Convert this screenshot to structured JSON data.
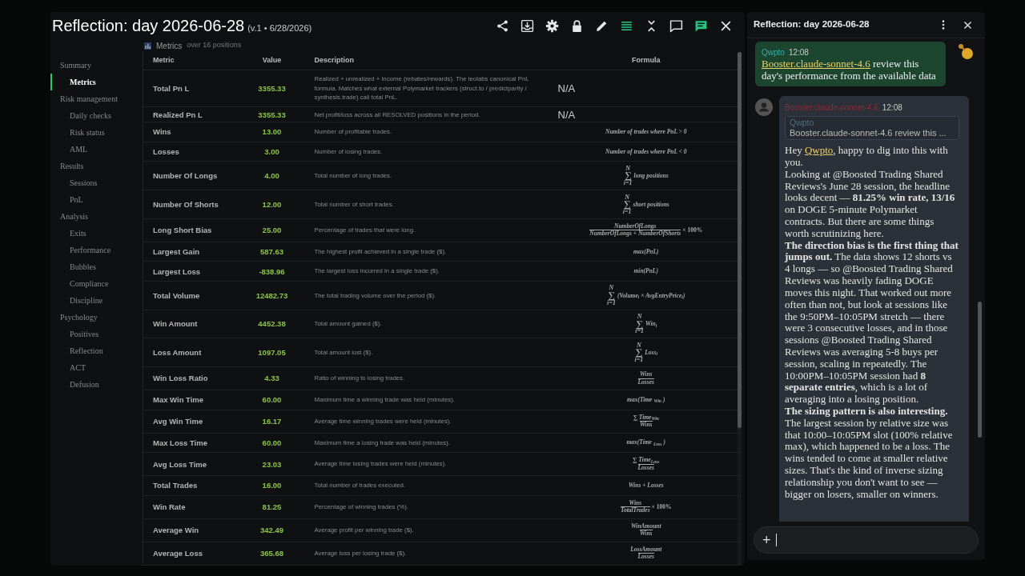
{
  "window": {
    "title": "Reflection: day 2026-06-28",
    "version": "(v.1 • 6/28/2026)"
  },
  "toolbar": [
    {
      "kind": "share",
      "active": false
    },
    {
      "kind": "download",
      "active": false
    },
    {
      "kind": "gear",
      "active": false
    },
    {
      "kind": "lock",
      "active": false
    },
    {
      "kind": "pencil",
      "active": false
    },
    {
      "kind": "list",
      "active": true
    },
    {
      "kind": "collapse",
      "active": false
    },
    {
      "kind": "comment",
      "active": false
    },
    {
      "kind": "comment",
      "active": true
    },
    {
      "kind": "close",
      "active": false
    }
  ],
  "sidebar": {
    "items": [
      {
        "label": "Summary",
        "selected": false,
        "children": [
          {
            "label": "Metrics",
            "selected": true
          }
        ]
      },
      {
        "label": "Risk management",
        "selected": false,
        "children": [
          {
            "label": "Daily checks",
            "selected": false
          },
          {
            "label": "Risk status",
            "selected": false
          },
          {
            "label": "AML",
            "selected": false
          }
        ]
      },
      {
        "label": "Results",
        "selected": false,
        "children": [
          {
            "label": "Sessions",
            "selected": false
          },
          {
            "label": "PnL",
            "selected": false
          }
        ]
      },
      {
        "label": "Analysis",
        "selected": false,
        "children": [
          {
            "label": "Exits",
            "selected": false
          },
          {
            "label": "Performance",
            "selected": false
          },
          {
            "label": "Bubbles",
            "selected": false
          },
          {
            "label": "Compliance",
            "selected": false
          },
          {
            "label": "Discipline",
            "selected": false
          }
        ]
      },
      {
        "label": "Psychology",
        "selected": false,
        "children": [
          {
            "label": "Positives",
            "selected": false
          },
          {
            "label": "Reflection",
            "selected": false
          },
          {
            "label": "ACT",
            "selected": false
          },
          {
            "label": "Defusion",
            "selected": false
          }
        ]
      }
    ]
  },
  "section": {
    "title": "Metrics",
    "subtitle": "over 16 positions"
  },
  "table": {
    "columns": [
      "Metric",
      "Value",
      "Description",
      "Formula"
    ],
    "rows": [
      {
        "metric": "Total Pn L",
        "value": "3355.33",
        "description": "Realized + unrealized + income (rebates/rewards). The leolabs canonical PnL formula. Matches what external Polymarket trackers (struct.to / predictparity / synthesis.trade) call total PnL.",
        "formula": {
          "kind": "na",
          "text": "N/A"
        }
      },
      {
        "metric": "Realized Pn L",
        "value": "3355.33",
        "description": "Net profit/loss across all RESOLVED positions in the period.",
        "formula": {
          "kind": "na",
          "text": "N/A"
        }
      },
      {
        "metric": "Wins",
        "value": "13.00",
        "description": "Number of profitable trades.",
        "formula": {
          "kind": "text",
          "text": "Number of trades where PnL > 0"
        }
      },
      {
        "metric": "Losses",
        "value": "3.00",
        "description": "Number of losing trades.",
        "formula": {
          "kind": "text",
          "text": "Number of trades where PnL < 0"
        }
      },
      {
        "metric": "Number Of Longs",
        "value": "4.00",
        "description": "Total number of long trades.",
        "formula": {
          "kind": "sum",
          "upper": "N",
          "sign": "∑",
          "lower": "i=1",
          "body": "long positions"
        }
      },
      {
        "metric": "Number Of Shorts",
        "value": "12.00",
        "description": "Total number of short trades.",
        "formula": {
          "kind": "sum",
          "upper": "N",
          "sign": "∑",
          "lower": "i=1",
          "body": "short positions"
        }
      },
      {
        "metric": "Long Short Bias",
        "value": "25.00",
        "description": "Percentage of trades that were long.",
        "formula": {
          "kind": "fraction",
          "num": "NumberOfLongs",
          "den": "NumberOfLongs + NumberOfShorts",
          "suffix": "× 100%"
        }
      },
      {
        "metric": "Largest Gain",
        "value": "587.63",
        "description": "The highest profit achieved in a single trade ($).",
        "formula": {
          "kind": "text",
          "text": "max(PnL)"
        }
      },
      {
        "metric": "Largest Loss",
        "value": "-838.96",
        "description": "The largest loss incurred in a single trade ($).",
        "formula": {
          "kind": "text",
          "text": "min(PnL)"
        }
      },
      {
        "metric": "Total Volume",
        "value": "12482.73",
        "description": "The total trading volume over the period ($).",
        "formula": {
          "kind": "sum",
          "upper": "N",
          "sign": "∑",
          "lower": "i=1",
          "body": "(Volume$_{i}$ × AvgEntryPrice$_{i}$)"
        }
      },
      {
        "metric": "Win Amount",
        "value": "4452.38",
        "description": "Total amount gained ($).",
        "formula": {
          "kind": "sum",
          "upper": "N",
          "sign": "∑",
          "lower": "i=1",
          "body": "Win$_{i}$"
        }
      },
      {
        "metric": "Loss Amount",
        "value": "1097.05",
        "description": "Total amount lost ($).",
        "formula": {
          "kind": "sum",
          "upper": "N",
          "sign": "∑",
          "lower": "i=1",
          "body": "Loss$_{i}$"
        }
      },
      {
        "metric": "Win Loss Ratio",
        "value": "4.33",
        "description": "Ratio of winning to losing trades.",
        "formula": {
          "kind": "fraction",
          "num": "Wins",
          "den": "Losses"
        }
      },
      {
        "metric": "Max Win Time",
        "value": "60.00",
        "description": "Maximum time a winning trade was held (minutes).",
        "formula": {
          "kind": "text",
          "text": "max(Time$_{Win}$)"
        }
      },
      {
        "metric": "Avg Win Time",
        "value": "16.17",
        "description": "Average time winning trades were held (minutes).",
        "formula": {
          "kind": "fraction",
          "num": "∑ Time$_{Win}$",
          "den": "Wins"
        }
      },
      {
        "metric": "Max Loss Time",
        "value": "60.00",
        "description": "Maximum time a losing trade was held (minutes).",
        "formula": {
          "kind": "text",
          "text": "max(Time$_{Loss}$)"
        }
      },
      {
        "metric": "Avg Loss Time",
        "value": "23.03",
        "description": "Average time losing trades were held (minutes).",
        "formula": {
          "kind": "fraction",
          "num": "∑ Time$_{Loss}$",
          "den": "Losses"
        }
      },
      {
        "metric": "Total Trades",
        "value": "16.00",
        "description": "Total number of trades executed.",
        "formula": {
          "kind": "text",
          "text": "Wins + Losses"
        }
      },
      {
        "metric": "Win Rate",
        "value": "81.25",
        "description": "Percentage of winning trades (%).",
        "formula": {
          "kind": "fraction",
          "num": "Wins",
          "den": "TotalTrades",
          "suffix": "× 100%"
        }
      },
      {
        "metric": "Average Win",
        "value": "342.49",
        "description": "Average profit per winning trade ($).",
        "formula": {
          "kind": "fraction",
          "num": "WinAmount",
          "den": "Wins"
        }
      },
      {
        "metric": "Average Loss",
        "value": "365.68",
        "description": "Average loss per losing trade ($).",
        "formula": {
          "kind": "fraction",
          "num": "LossAmount",
          "den": "Losses"
        }
      }
    ]
  },
  "chat": {
    "title": "Reflection: day 2026-06-28",
    "messages": [
      {
        "kind": "mine",
        "author": "Qwpto",
        "time": "12:08",
        "mention": "Booster.claude-sonnet-4.6",
        "text": "review this day's performance from the available data"
      },
      {
        "kind": "bot",
        "author": "Booster.claude-sonnet-4.6",
        "time": "12:08",
        "quote": {
          "author": "Qwpto",
          "text": "Booster.claude-sonnet-4.6 review this ..."
        },
        "greeting": {
          "before": "Hey",
          "mention": "Qwpto",
          "after": ", happy to dig into this with you."
        },
        "paragraphs": [
          "Looking at @Boosted Trading Shared Reviews's June 28 session, the headline looks decent — **81.25% win rate, 13/16** on DOGE 5-minute Polymarket contracts. But there are some things worth scrutinizing here.",
          "**The direction bias is the first thing that jumps out.** The data shows 12 shorts vs 4 longs — so @Boosted Trading Shared Reviews was heavily fading DOGE moves this night. That worked out more often than not, but look at sessions like the 9:50PM–10:05PM stretch — there were 3 consecutive losses, and in those sessions @Boosted Trading Shared Reviews was averaging 5-8 buys per session, scaling in repeatedly. The 10:00PM–10:05PM session had **8 separate entries**, which is a lot of averaging into a losing position.",
          "**The sizing pattern is also interesting.** The largest session by relative size was that 10:00–10:05PM slot (100% relative max), which happened to be a loss. The wins tended to come at smaller relative sizes. That's the kind of inverse sizing relationship you don't want to see — bigger on losers, smaller on winners."
        ]
      }
    ],
    "composer": {
      "add": "+"
    }
  }
}
